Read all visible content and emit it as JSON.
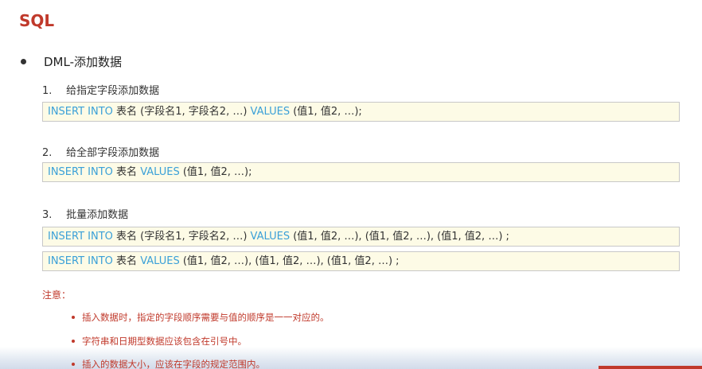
{
  "title": "SQL",
  "section": "DML-添加数据",
  "subsections": [
    {
      "num": "1.",
      "label": "给指定字段添加数据"
    },
    {
      "num": "2.",
      "label": "给全部字段添加数据"
    },
    {
      "num": "3.",
      "label": "批量添加数据"
    }
  ],
  "code": {
    "line1": {
      "kw1": "INSERT INTO",
      "t1": " 表名 (字段名1, 字段名2, …) ",
      "kw2": "VALUES",
      "t2": " (值1, 值2, …);"
    },
    "line2": {
      "kw1": "INSERT INTO",
      "t1": " 表名 ",
      "kw2": "VALUES",
      "t2": " (值1, 值2, …);"
    },
    "line3": {
      "kw1": "INSERT INTO",
      "t1": " 表名 (字段名1, 字段名2, …) ",
      "kw2": "VALUES",
      "t2": " (值1, 值2, …), (值1, 值2, …), (值1, 值2, …) ;"
    },
    "line4": {
      "kw1": "INSERT INTO",
      "t1": " 表名 ",
      "kw2": "VALUES",
      "t2": " (值1, 值2, …), (值1, 值2, …), (值1, 值2, …) ;"
    }
  },
  "notes_label": "注意：",
  "notes": [
    "插入数据时，指定的字段顺序需要与值的顺序是一一对应的。",
    "字符串和日期型数据应该包含在引号中。",
    "插入的数据大小，应该在字段的规定范围内。"
  ],
  "colors": {
    "title": "#c0392b",
    "keyword": "#3aa0d8",
    "note": "#c0392b",
    "code_bg": "#fdfbe6"
  }
}
